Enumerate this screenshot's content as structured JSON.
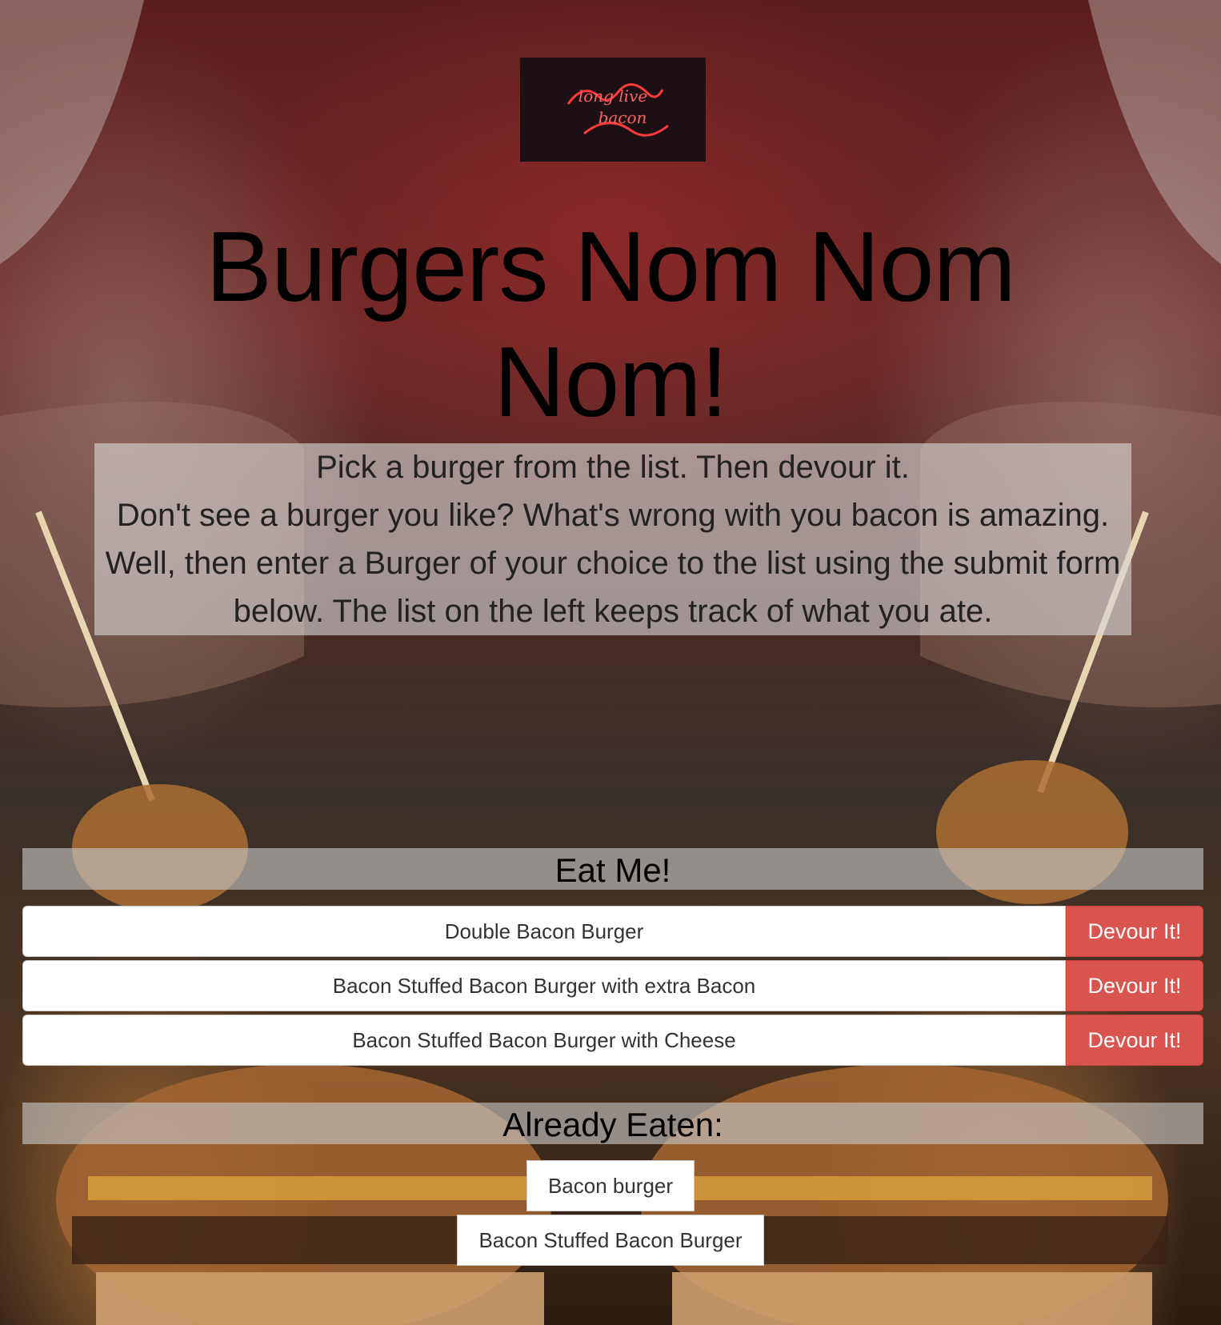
{
  "logo": {
    "line1": "long live",
    "line2": "bacon"
  },
  "page_title": "Burgers Nom Nom Nom!",
  "intro": {
    "line1": "Pick a burger from the list. Then devour it.",
    "line2": "Don't see a burger you like? What's wrong with you bacon is amazing.",
    "line3": "Well, then enter a Burger of your choice to the list using the submit form below. The list on the left keeps track of what you ate."
  },
  "eat_section": {
    "title": "Eat Me!",
    "button_label": "Devour It!",
    "items": [
      {
        "name": "Double Bacon Burger"
      },
      {
        "name": "Bacon Stuffed Bacon Burger with extra Bacon"
      },
      {
        "name": "Bacon Stuffed Bacon Burger with Cheese"
      }
    ]
  },
  "eaten_section": {
    "title": "Already Eaten:",
    "items": [
      {
        "name": "Bacon burger"
      },
      {
        "name": "Bacon Stuffed Bacon Burger"
      }
    ]
  },
  "colors": {
    "devour_button": "#d9534f",
    "neon": "#ff3a3a"
  }
}
